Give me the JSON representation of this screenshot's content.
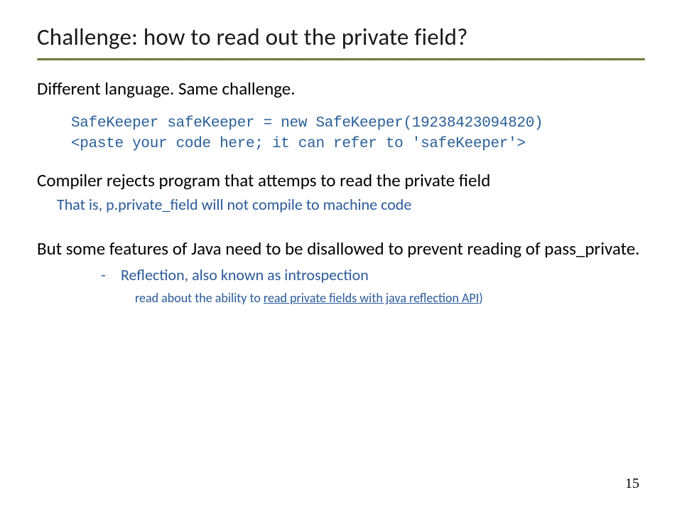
{
  "title": "Challenge: how to read out the private field?",
  "intro": "Different language.  Same challenge.",
  "code": {
    "line1": "SafeKeeper safeKeeper = new SafeKeeper(19238423094820)",
    "line2": "<paste your code here; it can refer to 'safeKeeper'>"
  },
  "compiler": {
    "heading": "Compiler rejects program that attemps to read the private field",
    "note": "That is, p.private_field will not compile to machine code"
  },
  "java": {
    "heading": "But some features of Java need to be disallowed to prevent reading of pass_private.",
    "bullet_dash": "-",
    "bullet": "Reflection, also known as introspection",
    "read_prefix": "read about the ability to ",
    "read_link": "read private fields with java reflection API",
    "read_suffix": ")"
  },
  "page_number": "15"
}
